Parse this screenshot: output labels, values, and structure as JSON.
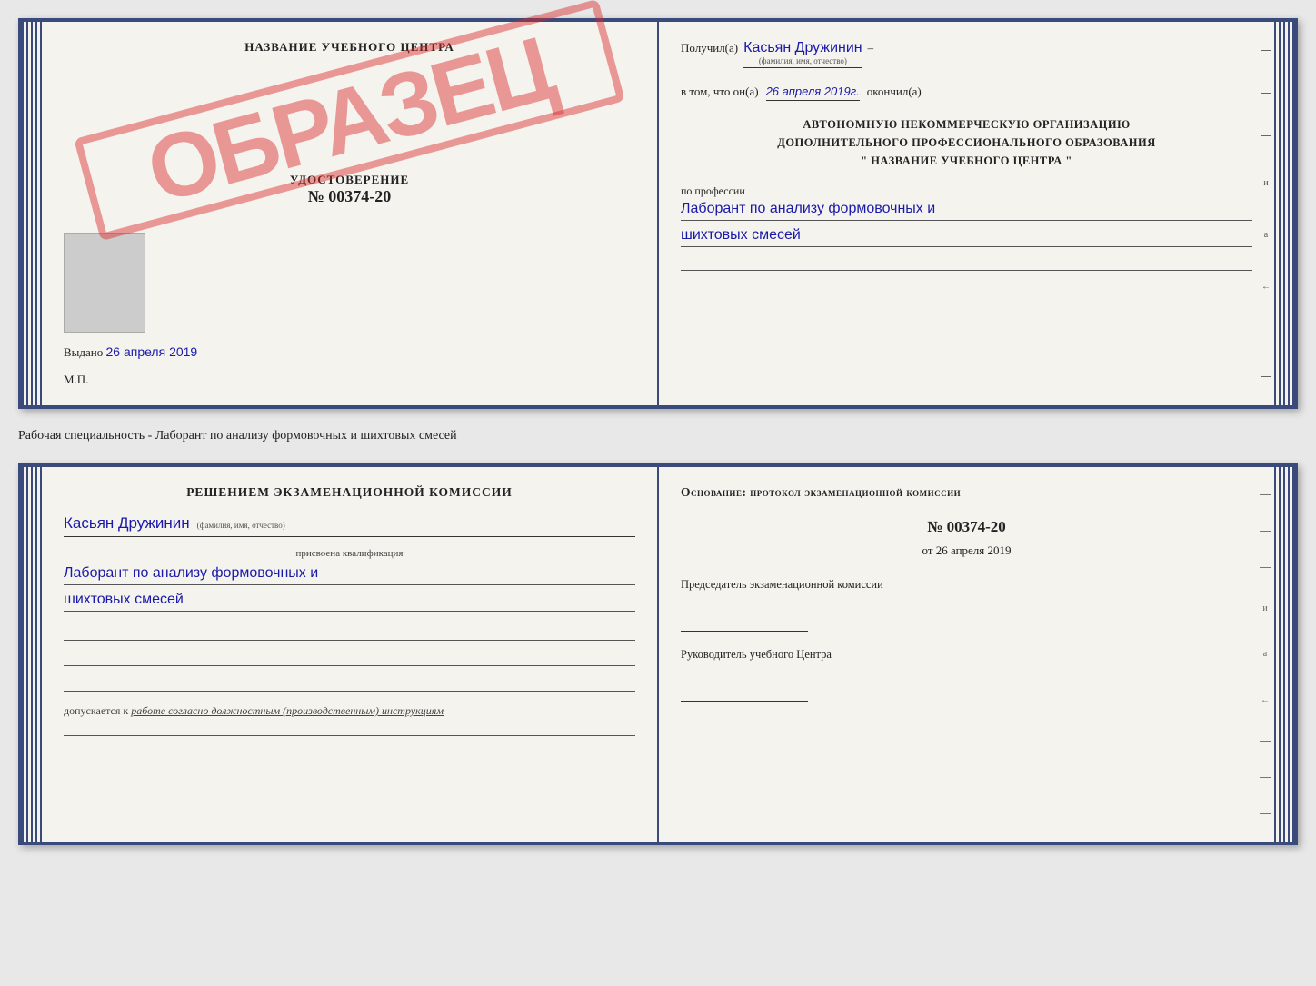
{
  "top_doc": {
    "left": {
      "title": "НАЗВАНИЕ УЧЕБНОГО ЦЕНТРА",
      "stamp": "ОБРАЗЕЦ",
      "cert_label": "УДОСТОВЕРЕНИЕ",
      "cert_number": "№ 00374-20",
      "issued_prefix": "Выдано",
      "issued_date_handwritten": "26 апреля 2019",
      "mp": "М.П."
    },
    "right": {
      "received_prefix": "Получил(а)",
      "received_name": "Касьян Дружинин",
      "fio_label": "(фамилия, имя, отчество)",
      "vtom_prefix": "в том, что он(а)",
      "vtom_date": "26 апреля 2019г.",
      "okончил": "окончил(а)",
      "org_line1": "АВТОНОМНУЮ НЕКОММЕРЧЕСКУЮ ОРГАНИЗАЦИЮ",
      "org_line2": "ДОПОЛНИТЕЛЬНОГО ПРОФЕССИОНАЛЬНОГО ОБРАЗОВАНИЯ",
      "org_line3": "\" НАЗВАНИЕ УЧЕБНОГО ЦЕНТРА \"",
      "profession_label": "по профессии",
      "profession_text_line1": "Лаборант по анализу формовочных и",
      "profession_text_line2": "шихтовых смесей",
      "right_side_letters": [
        "и",
        "а",
        "←",
        "–",
        "–"
      ]
    }
  },
  "between": {
    "text": "Рабочая специальность - Лаборант по анализу формовочных и шихтовых смесей"
  },
  "bottom_doc": {
    "left": {
      "decision_title": "Решением экзаменационной комиссии",
      "person_name": "Касьян Дружинин",
      "fio_label": "(фамилия, имя, отчество)",
      "qualification_label": "присвоена квалификация",
      "qualification_line1": "Лаборант по анализу формовочных и",
      "qualification_line2": "шихтовых смесей",
      "допускается_prefix": "допускается к",
      "допускается_text": "работе согласно должностным (производственным) инструкциям"
    },
    "right": {
      "osnovanye": "Основание: протокол экзаменационной комиссии",
      "protocol_number": "№ 00374-20",
      "protocol_date_prefix": "от",
      "protocol_date": "26 апреля 2019",
      "chairman_label": "Председатель экзаменационной комиссии",
      "director_label": "Руководитель учебного Центра",
      "right_side_letters": [
        "и",
        "а",
        "←",
        "–",
        "–",
        "–"
      ]
    }
  }
}
